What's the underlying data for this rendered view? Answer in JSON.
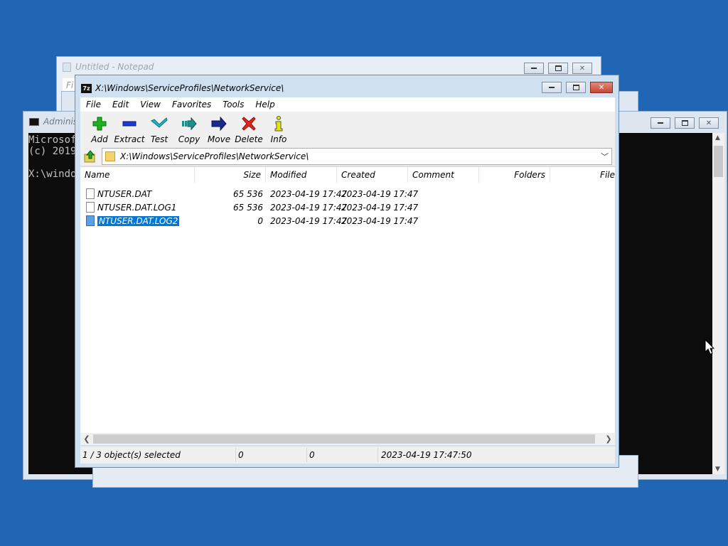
{
  "notepad": {
    "title": "Untitled - Notepad",
    "menu_first": "Fi"
  },
  "cmd": {
    "title": "Adminis",
    "lines": [
      "Microsof",
      "(c) 2019",
      "",
      "X:\\windo"
    ]
  },
  "zip": {
    "title": "X:\\Windows\\ServiceProfiles\\NetworkService\\",
    "menu": [
      "File",
      "Edit",
      "View",
      "Favorites",
      "Tools",
      "Help"
    ],
    "toolbar": [
      {
        "label": "Add",
        "icon": "plus-icon",
        "color": "#1db31d"
      },
      {
        "label": "Extract",
        "icon": "minus-icon",
        "color": "#1b3ad6"
      },
      {
        "label": "Test",
        "icon": "check-icon",
        "color": "#27b6c4"
      },
      {
        "label": "Copy",
        "icon": "copy-arrow-icon",
        "color": "#1f8f8a"
      },
      {
        "label": "Move",
        "icon": "move-arrow-icon",
        "color": "#1b2a8c"
      },
      {
        "label": "Delete",
        "icon": "delete-x-icon",
        "color": "#e0261e"
      },
      {
        "label": "Info",
        "icon": "info-icon",
        "color": "#e6e600"
      }
    ],
    "address": "X:\\Windows\\ServiceProfiles\\NetworkService\\",
    "columns": [
      "Name",
      "Size",
      "Modified",
      "Created",
      "Comment",
      "Folders",
      "File"
    ],
    "files": [
      {
        "name": "NTUSER.DAT",
        "size": "65 536",
        "modified": "2023-04-19 17:47",
        "created": "2023-04-19 17:47",
        "selected": false
      },
      {
        "name": "NTUSER.DAT.LOG1",
        "size": "65 536",
        "modified": "2023-04-19 17:47",
        "created": "2023-04-19 17:47",
        "selected": false
      },
      {
        "name": "NTUSER.DAT.LOG2",
        "size": "0",
        "modified": "2023-04-19 17:47",
        "created": "2023-04-19 17:47",
        "selected": true
      }
    ],
    "status": {
      "selection": "1 / 3 object(s) selected",
      "size": "0",
      "packed": "0",
      "datetime": "2023-04-19 17:47:50"
    }
  },
  "colors": {
    "desktop": "#2166b5",
    "selection": "#0078d7"
  }
}
